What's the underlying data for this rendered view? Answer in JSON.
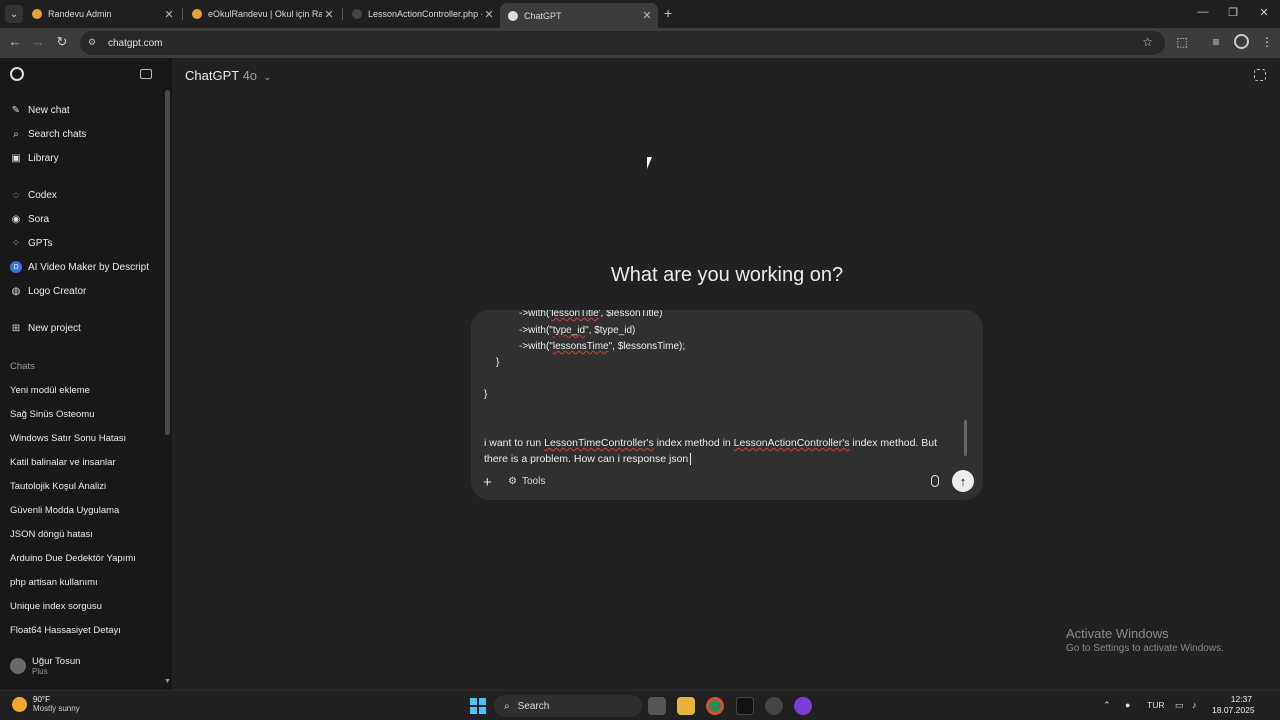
{
  "browser": {
    "tabs": [
      {
        "title": "Randevu Admin",
        "active": false,
        "favicon_color": "#e8a33c"
      },
      {
        "title": "eOkulRandevu | Okul için Rand...",
        "active": false,
        "favicon_color": "#e8a33c"
      },
      {
        "title": "LessonActionController.php - p...",
        "active": false,
        "favicon_color": "#444444"
      },
      {
        "title": "ChatGPT",
        "active": true,
        "favicon_color": "#dddddd"
      }
    ],
    "url": "chatgpt.com"
  },
  "sidebar": {
    "nav": [
      {
        "label": "New chat",
        "icon": "edit-icon"
      },
      {
        "label": "Search chats",
        "icon": "search-icon"
      },
      {
        "label": "Library",
        "icon": "library-icon"
      }
    ],
    "apps": [
      {
        "label": "Codex",
        "icon": "codex-icon"
      },
      {
        "label": "Sora",
        "icon": "sora-icon"
      },
      {
        "label": "GPTs",
        "icon": "grid-icon"
      },
      {
        "label": "AI Video Maker by Descript",
        "icon": "descript-icon"
      },
      {
        "label": "Logo Creator",
        "icon": "logo-creator-icon"
      }
    ],
    "new_project": "New project",
    "chats_heading": "Chats",
    "chats": [
      "Yeni modül ekleme",
      "Sağ Sinüs Osteomu",
      "Windows Satır Sonu Hatası",
      "Katil balinalar ve insanlar",
      "Tautolojik Koşul Analizi",
      "Güvenli Modda Uygulama",
      "JSON döngü hatası",
      "Arduino Due Dedektör Yapımı",
      "php artisan kullanımı",
      "Unique index sorgusu",
      "Float64 Hassasiyet Detayı"
    ],
    "user": {
      "name": "Uğur Tosun",
      "plan": "Plus"
    }
  },
  "main": {
    "model_name": "ChatGPT",
    "model_version": "4o",
    "heading": "What are you working on?",
    "composer": {
      "code_lines": [
        {
          "prefix": "->with('",
          "ident": "lessonTitle",
          "suffix": "', $lessonTitle)"
        },
        {
          "prefix": "->with(\"",
          "ident": "type_id",
          "suffix": "\", $type_id)"
        },
        {
          "prefix": "->with(\"",
          "ident": "lessonsTime",
          "suffix": "\", $lessonsTime);"
        },
        {
          "prefix": "}",
          "ident": "",
          "suffix": ""
        },
        {
          "prefix": "}",
          "ident": "",
          "suffix": ""
        }
      ],
      "message_parts": {
        "p1": "i want to run ",
        "w1": "LessonTimeController's",
        "p2": " index method in ",
        "w2": "LessonActionController's",
        "p3": " index method. But there is a problem. How can i response json"
      },
      "tools_label": "Tools"
    }
  },
  "watermark": {
    "line1": "Activate Windows",
    "line2": "Go to Settings to activate Windows."
  },
  "taskbar": {
    "weather_temp": "90°F",
    "weather_desc": "Mostly sunny",
    "search_label": "Search",
    "language": "TUR",
    "time": "12:37",
    "date": "18.07.2025"
  }
}
